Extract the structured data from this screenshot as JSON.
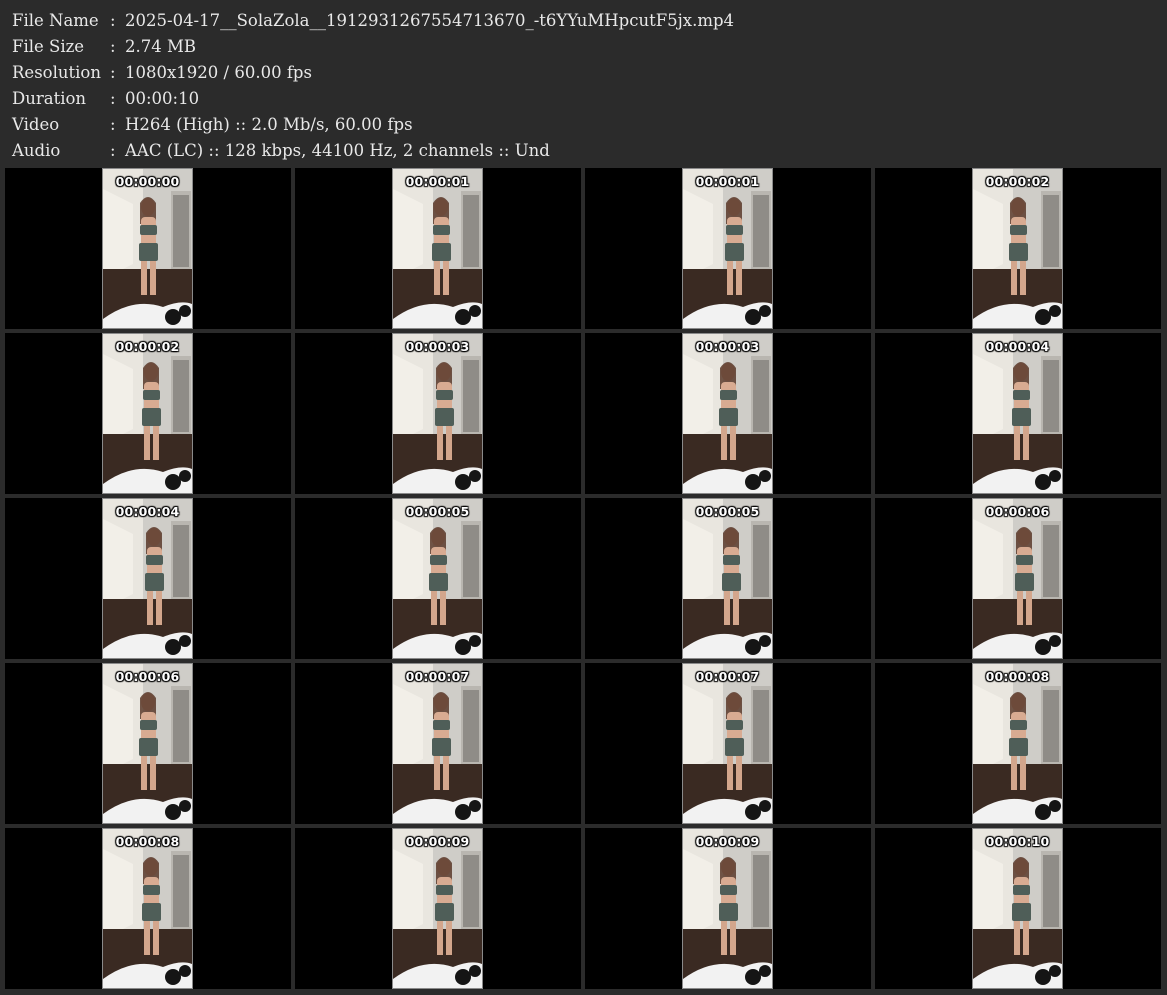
{
  "info": [
    {
      "label": "File Name",
      "sep": ":",
      "value": "2025-04-17__SolaZola__1912931267554713670_-t6YYuMHpcutF5jx.mp4"
    },
    {
      "label": "File Size",
      "sep": ":",
      "value": "2.74 MB"
    },
    {
      "label": "Resolution",
      "sep": ":",
      "value": "1080x1920 / 60.00 fps"
    },
    {
      "label": "Duration",
      "sep": ":",
      "value": "00:00:10"
    },
    {
      "label": "Video",
      "sep": ":",
      "value": "H264 (High) :: 2.0 Mb/s, 60.00 fps"
    },
    {
      "label": "Audio",
      "sep": ":",
      "value": "AAC (LC) :: 128 kbps, 44100 Hz, 2 channels :: Und"
    }
  ],
  "grid": {
    "columns": 4,
    "rows": 5
  },
  "thumbnails": [
    {
      "time": "00:00:00"
    },
    {
      "time": "00:00:01"
    },
    {
      "time": "00:00:01"
    },
    {
      "time": "00:00:02"
    },
    {
      "time": "00:00:02"
    },
    {
      "time": "00:00:03"
    },
    {
      "time": "00:00:03"
    },
    {
      "time": "00:00:04"
    },
    {
      "time": "00:00:04"
    },
    {
      "time": "00:00:05"
    },
    {
      "time": "00:00:05"
    },
    {
      "time": "00:00:06"
    },
    {
      "time": "00:00:06"
    },
    {
      "time": "00:00:07"
    },
    {
      "time": "00:00:07"
    },
    {
      "time": "00:00:08"
    },
    {
      "time": "00:00:08"
    },
    {
      "time": "00:00:09"
    },
    {
      "time": "00:00:09"
    },
    {
      "time": "00:00:10"
    }
  ],
  "colors": {
    "background": "#2b2b2b",
    "text": "#e8e8e8",
    "cell": "#000000",
    "outfit": "#4f5e58"
  }
}
